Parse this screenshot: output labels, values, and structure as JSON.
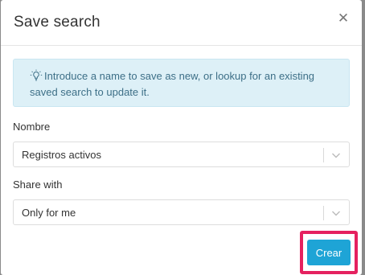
{
  "modal": {
    "title": "Save search",
    "close_icon": "close-icon"
  },
  "info": {
    "icon": "lightbulb-icon",
    "text": "Introduce a name to save as new, or lookup for an existing saved search to update it."
  },
  "fields": {
    "name_label": "Nombre",
    "name_value": "Registros activos",
    "share_label": "Share with",
    "share_value": "Only for me"
  },
  "actions": {
    "create_label": "Crear"
  },
  "colors": {
    "accent": "#1ea4d6",
    "highlight": "#e5215f",
    "info_bg": "#ddf0f7",
    "info_text": "#3d6f87"
  }
}
